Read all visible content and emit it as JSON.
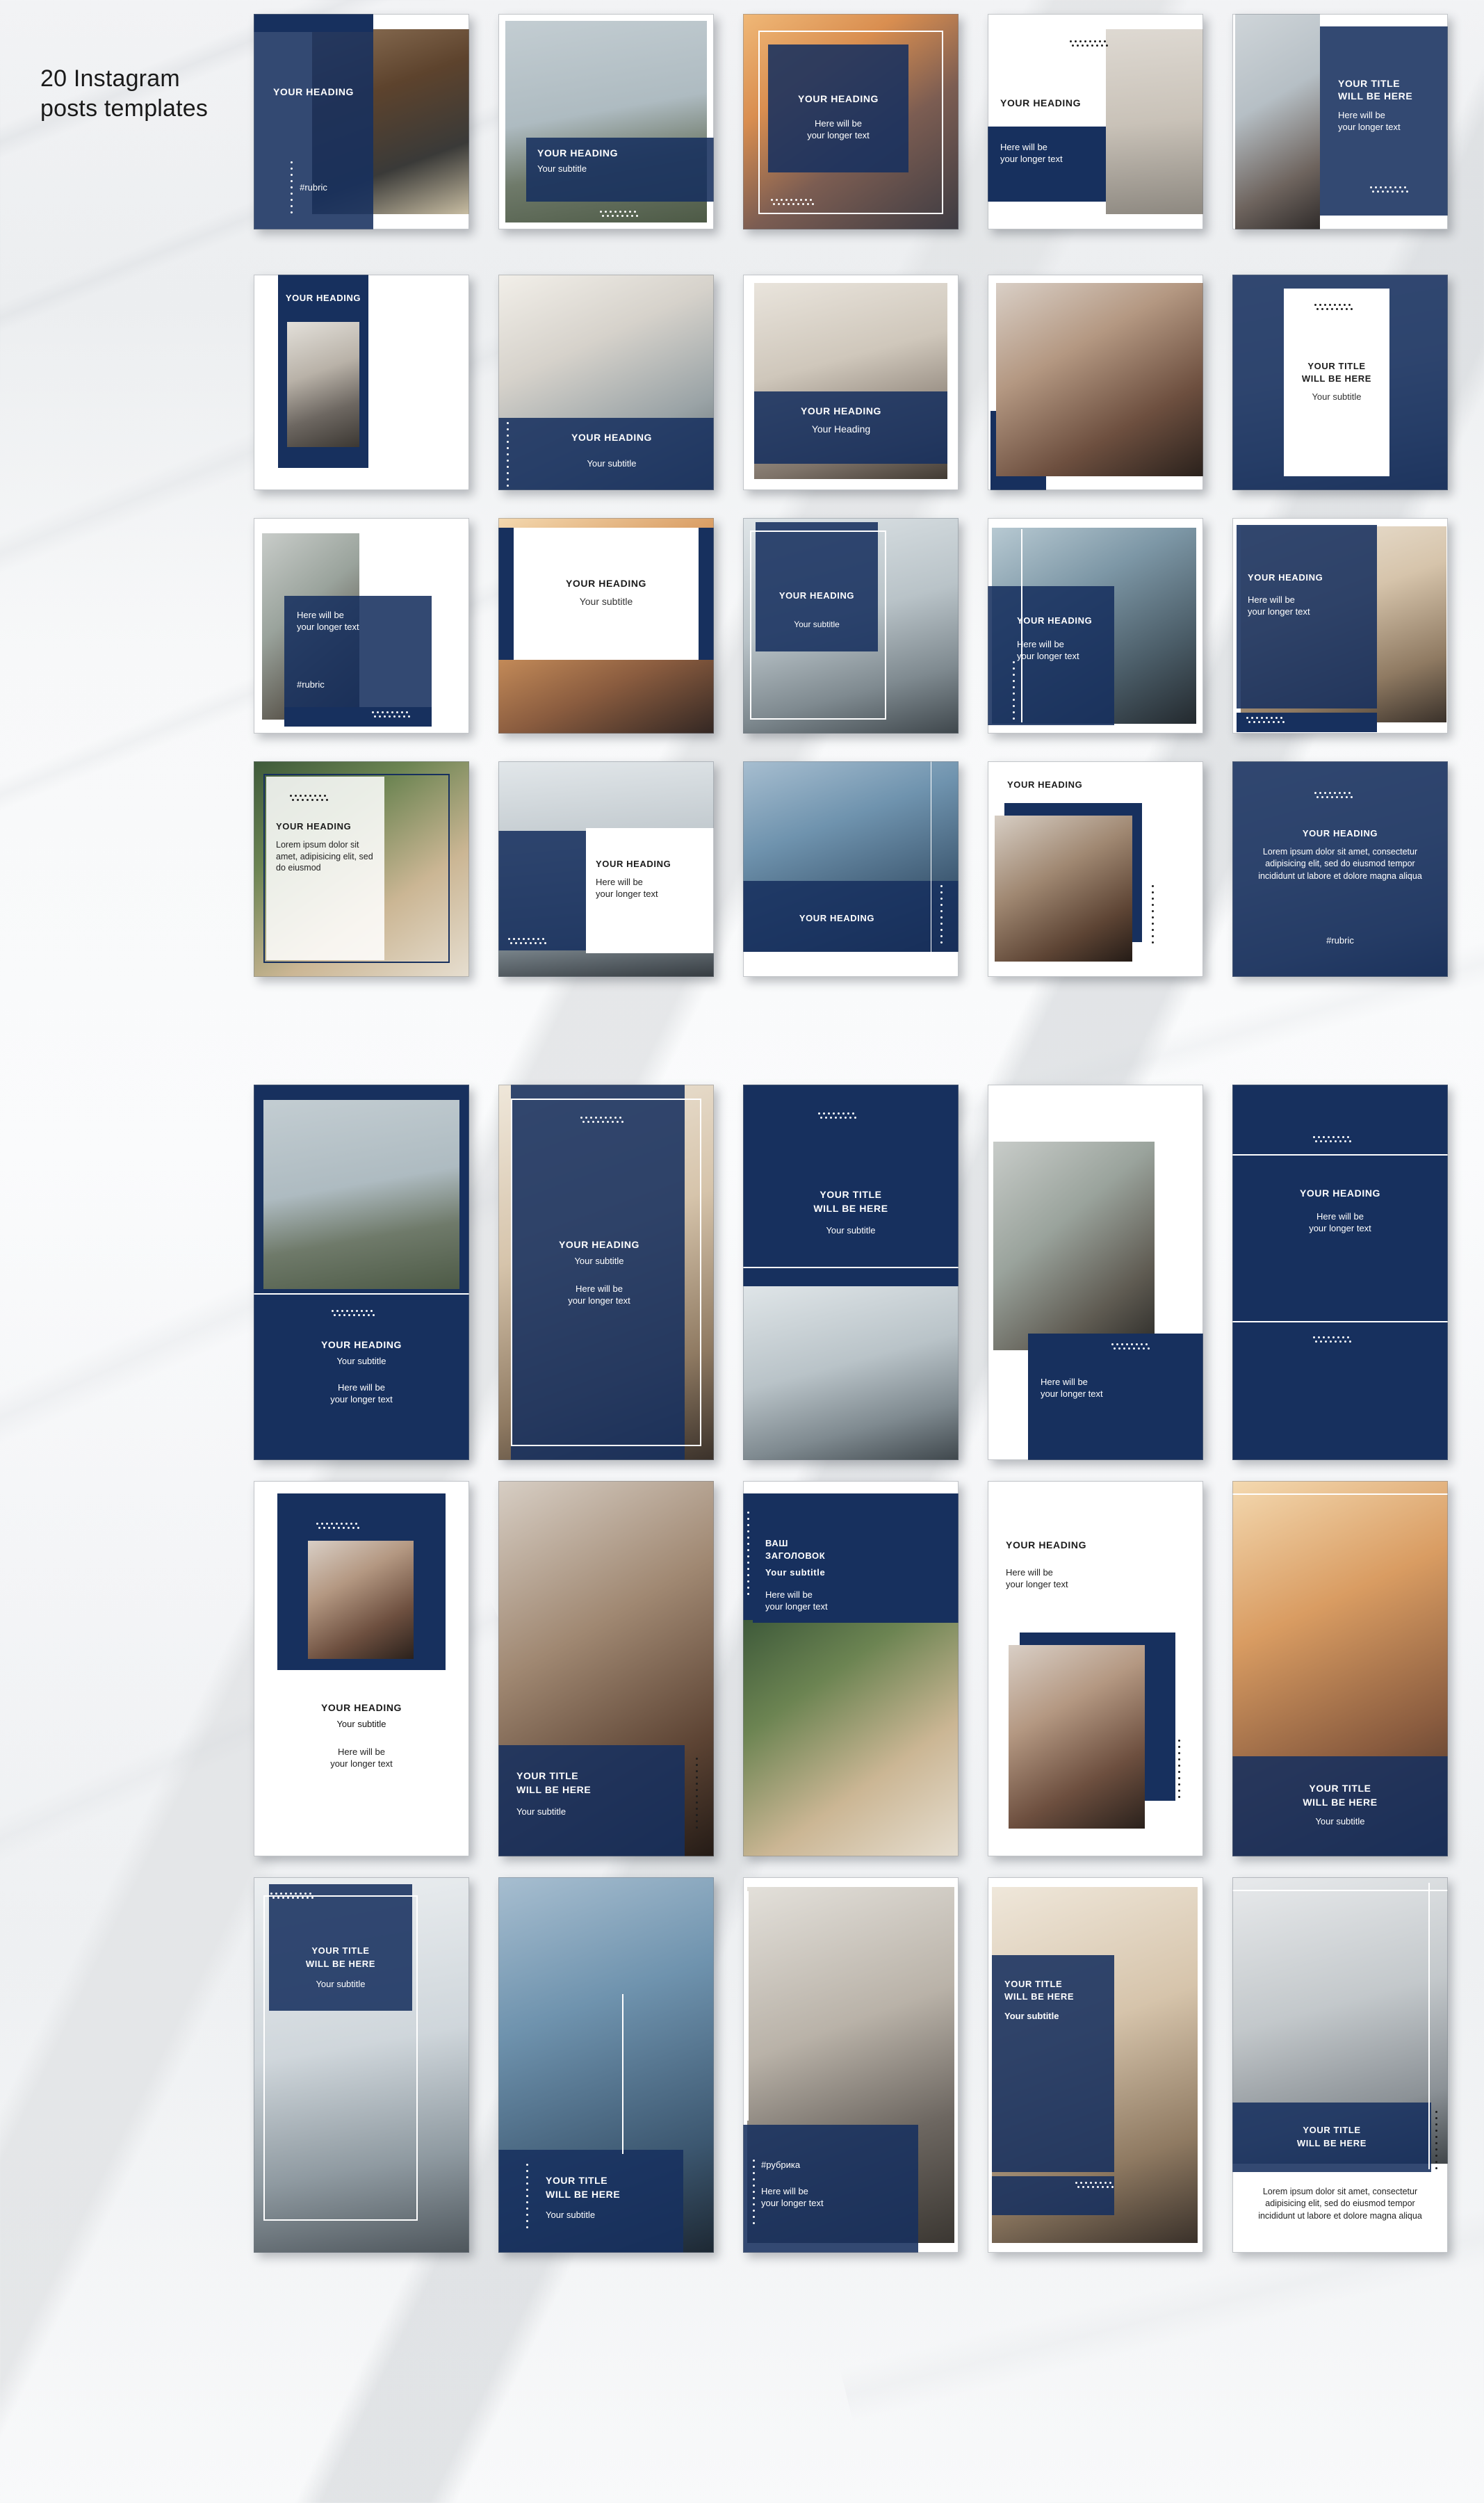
{
  "page": {
    "title_line1": "20 Instagram",
    "title_line2": "posts templates",
    "brand_navy": "#17305e",
    "background": "#f4f6f8"
  },
  "strings": {
    "heading": "YOUR HEADING",
    "title_2line_a": "YOUR TITLE",
    "title_2line_b": "WILL BE HERE",
    "subtitle": "Your subtitle",
    "longer_a": "Here will be",
    "longer_b": "your longer text",
    "rubric": "#rubric",
    "rubric_ru": "#рубрика",
    "heading_ru_a": "ВАШ",
    "heading_ru_b": "ЗАГОЛОВОК",
    "heading_mixed": "Your Heading",
    "lorem_short": "Lorem ipsum dolor sit amet, adipisicing elit, sed do eiusmod",
    "lorem_long": "Lorem ipsum dolor sit amet, consectetur adipisicing elit, sed do eiusmod tempor incididunt ut labore et dolore magna aliqua"
  },
  "posts_section": {
    "label": "square-instagram-posts",
    "count": 20,
    "items": [
      {
        "id": 1,
        "layout": "split-left-navy-photo-right",
        "heading": "YOUR HEADING",
        "rubric": "#rubric",
        "photo": "p1"
      },
      {
        "id": 2,
        "layout": "photo-top-navy-band-bottom",
        "heading": "YOUR HEADING",
        "subtitle": "Your subtitle",
        "photo": "p2"
      },
      {
        "id": 3,
        "layout": "photo-full-navy-panel-frame",
        "heading": "YOUR HEADING",
        "longer_a": "Here will be",
        "longer_b": "your longer text",
        "photo": "p3"
      },
      {
        "id": 4,
        "layout": "white-left-heading-photo-right",
        "heading": "YOUR HEADING",
        "longer_a": "Here will be",
        "longer_b": "your longer text",
        "photo": "p4"
      },
      {
        "id": 5,
        "layout": "photo-left-navy-right",
        "title_a": "YOUR TITLE",
        "title_b": "WILL BE HERE",
        "longer_a": "Here will be",
        "longer_b": "your longer text",
        "photo": "p5"
      },
      {
        "id": 6,
        "layout": "navy-card-photo-inset",
        "heading": "YOUR HEADING",
        "photo": "p6"
      },
      {
        "id": 7,
        "layout": "photo-top-navy-bottom-dots",
        "heading": "YOUR HEADING",
        "subtitle": "Your subtitle",
        "photo": "p7"
      },
      {
        "id": 8,
        "layout": "photo-navy-overlay-mid",
        "heading": "YOUR HEADING",
        "subheading": "Your Heading",
        "photo": "p8"
      },
      {
        "id": 9,
        "layout": "photo-only-navy-corner",
        "photo": "p9"
      },
      {
        "id": 10,
        "layout": "navy-bg-white-card",
        "title_a": "YOUR TITLE",
        "title_b": "WILL BE HERE",
        "subtitle": "Your subtitle",
        "photo": "p10"
      },
      {
        "id": 11,
        "layout": "photo-left-navy-block-rubric",
        "longer_a": "Here will be",
        "longer_b": "your longer text",
        "rubric": "#rubric",
        "photo": "p11"
      },
      {
        "id": 12,
        "layout": "white-card-over-photo",
        "heading": "YOUR HEADING",
        "subtitle": "Your subtitle",
        "photo": "p12"
      },
      {
        "id": 13,
        "layout": "photo-navy-overlay-frame",
        "heading": "YOUR HEADING",
        "subtitle": "Your subtitle",
        "photo": "p13"
      },
      {
        "id": 14,
        "layout": "photo-navy-panel-left",
        "heading": "YOUR HEADING",
        "longer_a": "Here will be",
        "longer_b": "your longer text",
        "photo": "p14"
      },
      {
        "id": 15,
        "layout": "navy-left-photo-right",
        "heading": "YOUR HEADING",
        "longer_a": "Here will be",
        "longer_b": "your longer text",
        "photo": "p15"
      },
      {
        "id": 16,
        "layout": "photo-white-panel-lorem",
        "heading": "YOUR HEADING",
        "lorem": "Lorem ipsum dolor sit amet, adipisicing elit, sed do eiusmod",
        "photo": "p16"
      },
      {
        "id": 17,
        "layout": "photo-top-white-card-right",
        "heading": "YOUR HEADING",
        "longer_a": "Here will be",
        "longer_b": "your longer text",
        "photo": "p17"
      },
      {
        "id": 18,
        "layout": "photo-navy-band-bottom",
        "heading": "YOUR HEADING",
        "photo": "p18"
      },
      {
        "id": 19,
        "layout": "white-heading-top-photo-inset",
        "heading": "YOUR HEADING",
        "photo": "p19"
      },
      {
        "id": 20,
        "layout": "navy-full-lorem-rubric",
        "heading": "YOUR HEADING",
        "lorem": "Lorem ipsum dolor sit amet, consectetur adipisicing elit, sed do eiusmod tempor incididunt ut labore et dolore magna aliqua",
        "rubric": "#rubric",
        "photo": "p20"
      }
    ]
  },
  "stories_section": {
    "label": "instagram-stories",
    "count": 15,
    "items": [
      {
        "id": 1,
        "heading": "YOUR HEADING",
        "subtitle": "Your subtitle",
        "longer_a": "Here will be",
        "longer_b": "your longer text",
        "photo": "p2"
      },
      {
        "id": 2,
        "heading": "YOUR HEADING",
        "subtitle": "Your subtitle",
        "longer_a": "Here will be",
        "longer_b": "your longer text",
        "photo": "p15"
      },
      {
        "id": 3,
        "title_a": "YOUR TITLE",
        "title_b": "WILL BE HERE",
        "subtitle": "Your subtitle",
        "photo": "p13"
      },
      {
        "id": 4,
        "longer_a": "Here will be",
        "longer_b": "your longer text",
        "photo": "p11"
      },
      {
        "id": 5,
        "heading": "YOUR HEADING",
        "longer_a": "Here will be",
        "longer_b": "your longer text"
      },
      {
        "id": 6,
        "heading": "YOUR HEADING",
        "subtitle": "Your subtitle",
        "longer_a": "Here will be",
        "longer_b": "your longer text",
        "photo": "p9"
      },
      {
        "id": 7,
        "title_a": "YOUR TITLE",
        "title_b": "WILL BE HERE",
        "subtitle": "Your subtitle",
        "photo": "p19"
      },
      {
        "id": 8,
        "heading_ru_a": "ВАШ",
        "heading_ru_b": "ЗАГОЛОВОК",
        "subtitle": "Your subtitle",
        "longer_a": "Here will be",
        "longer_b": "your longer text",
        "photo": "p16"
      },
      {
        "id": 9,
        "heading": "YOUR HEADING",
        "longer_a": "Here will be",
        "longer_b": "your longer text",
        "photo": "p9"
      },
      {
        "id": 10,
        "title_a": "YOUR TITLE",
        "title_b": "WILL BE HERE",
        "subtitle": "Your subtitle",
        "photo": "p12"
      },
      {
        "id": 11,
        "title_a": "YOUR TITLE",
        "title_b": "WILL BE HERE",
        "subtitle": "Your subtitle",
        "photo": "p10"
      },
      {
        "id": 12,
        "title_a": "YOUR TITLE",
        "title_b": "WILL BE HERE",
        "subtitle": "Your subtitle",
        "photo": "p18"
      },
      {
        "id": 13,
        "rubric_ru": "#рубрика",
        "longer_a": "Here will be",
        "longer_b": "your longer text",
        "photo": "p6"
      },
      {
        "id": 14,
        "title_a": "YOUR TITLE",
        "title_b": "WILL BE HERE",
        "subtitle": "Your subtitle",
        "photo": "p15"
      },
      {
        "id": 15,
        "title_a": "YOUR TITLE",
        "title_b": "WILL BE HERE",
        "lorem": "Lorem ipsum dolor sit amet, consectetur adipisicing elit, sed do eiusmod tempor incididunt ut labore et dolore magna aliqua",
        "photo": "p20"
      }
    ]
  }
}
